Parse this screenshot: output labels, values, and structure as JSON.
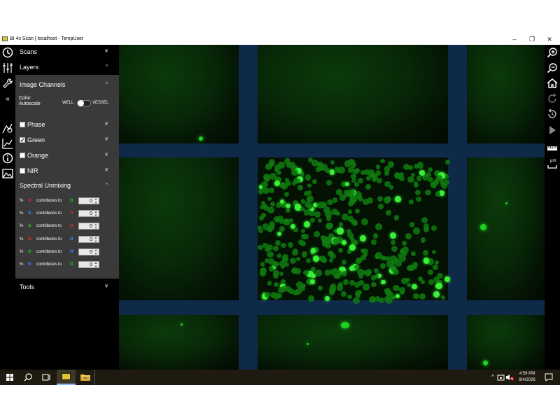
{
  "window": {
    "title": "BI 4x Scan | localhost - TempUser",
    "minimize_glyph": "–",
    "restore_glyph": "❐",
    "close_glyph": "✕"
  },
  "left_panel": {
    "scans_label": "Scans",
    "layers_label": "Layers",
    "image_channels_label": "Image Channels",
    "color_autoscale_label_1": "Color",
    "color_autoscale_label_2": "Autoscale",
    "toggle_left_label": "WELL",
    "toggle_right_label": "VESSEL",
    "collapse_glyph": "«",
    "channels": [
      {
        "label": "Phase",
        "checked": false,
        "check_glyph": ""
      },
      {
        "label": "Green",
        "checked": true,
        "check_glyph": "✓"
      },
      {
        "label": "Orange",
        "checked": false,
        "check_glyph": ""
      },
      {
        "label": "NIR",
        "checked": false,
        "check_glyph": ""
      }
    ],
    "spectral_unmixing_label": "Spectral Unmixing",
    "unmixing_rows": [
      {
        "pct": "%",
        "src": "O",
        "src_color": "#e03030",
        "mid": "contributes to",
        "dst": "G",
        "dst_color": "#22cc22",
        "value": "0"
      },
      {
        "pct": "%",
        "src": "N",
        "src_color": "#3a7cff",
        "mid": "contributes to",
        "dst": "O",
        "dst_color": "#e03030",
        "value": "0"
      },
      {
        "pct": "%",
        "src": "G",
        "src_color": "#22cc22",
        "mid": "contributes to",
        "dst": "O",
        "dst_color": "#e03030",
        "value": "0"
      },
      {
        "pct": "%",
        "src": "O",
        "src_color": "#e03030",
        "mid": "contributes to",
        "dst": "N",
        "dst_color": "#3a7cff",
        "value": "0"
      },
      {
        "pct": "%",
        "src": "G",
        "src_color": "#22cc22",
        "mid": "contributes to",
        "dst": "N",
        "dst_color": "#3a7cff",
        "value": "0"
      },
      {
        "pct": "%",
        "src": "N",
        "src_color": "#3a7cff",
        "mid": "contributes to",
        "dst": "G",
        "dst_color": "#22cc22",
        "value": "0"
      }
    ],
    "tools_label": "Tools",
    "chevron_down": "¥",
    "chevron_up": "^"
  },
  "right_rail": {
    "scale_label": "μm"
  },
  "taskbar": {
    "time": "4:59 PM",
    "date": "8/4/2026"
  },
  "colors": {
    "panel_bg": "#3a3a3a",
    "viewport_gap": "#0e2a48",
    "fluor_green": "#1fd21f",
    "taskbar_bg": "#1f1a10"
  }
}
